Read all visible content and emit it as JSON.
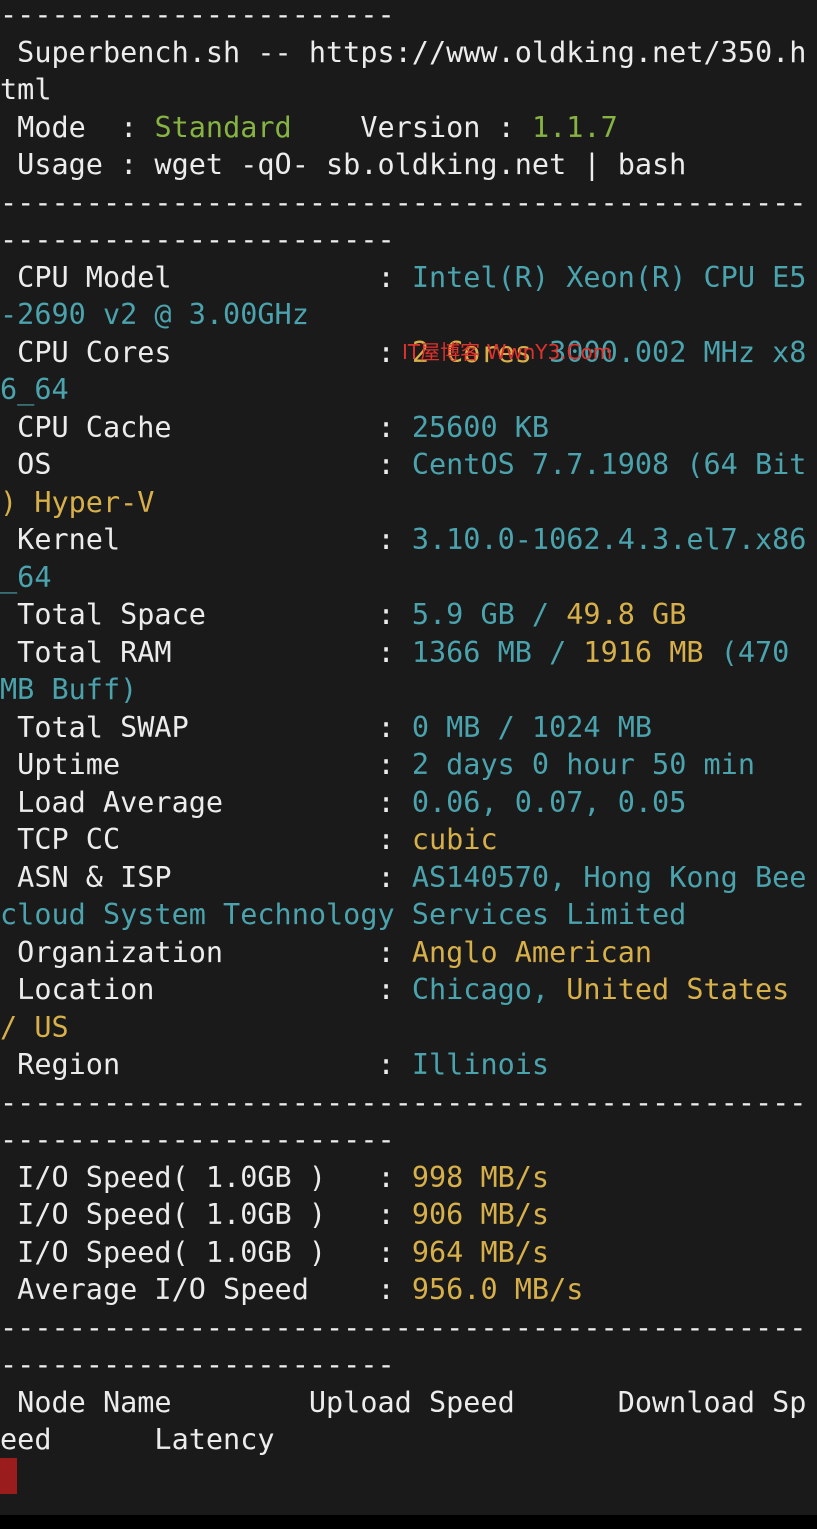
{
  "terminal": {
    "lines": [
      [
        {
          "t": "-----------------------",
          "c": "w"
        }
      ],
      [
        {
          "t": " Superbench.sh -- https://www.oldking.net/350.h",
          "c": "w"
        }
      ],
      [
        {
          "t": "tml",
          "c": "w"
        }
      ],
      [
        {
          "t": " Mode  : ",
          "c": "w"
        },
        {
          "t": "Standard",
          "c": "g"
        },
        {
          "t": "    Version : ",
          "c": "w"
        },
        {
          "t": "1.1.7",
          "c": "g"
        }
      ],
      [
        {
          "t": " Usage : wget -qO- sb.oldking.net | bash",
          "c": "w"
        }
      ],
      [
        {
          "t": "-----------------------------------------------",
          "c": "w"
        }
      ],
      [
        {
          "t": "-----------------------",
          "c": "w"
        }
      ],
      [
        {
          "t": " CPU Model            : ",
          "c": "w"
        },
        {
          "t": "Intel(R) Xeon(R) CPU E5",
          "c": "c"
        }
      ],
      [
        {
          "t": "-2690 v2 @ 3.00GHz",
          "c": "c"
        }
      ],
      [
        {
          "t": " CPU Cores            : ",
          "c": "w"
        },
        {
          "t": "2 Cores ",
          "c": "y"
        },
        {
          "t": "3000.002 MHz x8",
          "c": "c"
        }
      ],
      [
        {
          "t": "6_64",
          "c": "c"
        }
      ],
      [
        {
          "t": " CPU Cache            : ",
          "c": "w"
        },
        {
          "t": "25600 KB",
          "c": "c"
        }
      ],
      [
        {
          "t": " OS                   : ",
          "c": "w"
        },
        {
          "t": "CentOS 7.7.1908 (64 Bit",
          "c": "c"
        }
      ],
      [
        {
          "t": ") Hyper-V",
          "c": "y"
        }
      ],
      [
        {
          "t": " Kernel               : ",
          "c": "w"
        },
        {
          "t": "3.10.0-1062.4.3.el7.x86",
          "c": "c"
        }
      ],
      [
        {
          "t": "_64",
          "c": "c"
        }
      ],
      [
        {
          "t": " Total Space          : ",
          "c": "w"
        },
        {
          "t": "5.9 GB / ",
          "c": "c"
        },
        {
          "t": "49.8 GB",
          "c": "y"
        }
      ],
      [
        {
          "t": " Total RAM            : ",
          "c": "w"
        },
        {
          "t": "1366 MB / ",
          "c": "c"
        },
        {
          "t": "1916 MB",
          "c": "y"
        },
        {
          "t": " (470",
          "c": "c"
        }
      ],
      [
        {
          "t": "MB Buff)",
          "c": "c"
        }
      ],
      [
        {
          "t": " Total SWAP           : ",
          "c": "w"
        },
        {
          "t": "0 MB / 1024 MB",
          "c": "c"
        }
      ],
      [
        {
          "t": " Uptime               : ",
          "c": "w"
        },
        {
          "t": "2 days 0 hour 50 min",
          "c": "c"
        }
      ],
      [
        {
          "t": " Load Average         : ",
          "c": "w"
        },
        {
          "t": "0.06, 0.07, 0.05",
          "c": "c"
        }
      ],
      [
        {
          "t": " TCP CC               : ",
          "c": "w"
        },
        {
          "t": "cubic",
          "c": "y"
        }
      ],
      [
        {
          "t": " ASN & ISP            : ",
          "c": "w"
        },
        {
          "t": "AS140570, Hong Kong Bee",
          "c": "c"
        }
      ],
      [
        {
          "t": "cloud System Technology Services Limited",
          "c": "c"
        }
      ],
      [
        {
          "t": " Organization         : ",
          "c": "w"
        },
        {
          "t": "Anglo American",
          "c": "y"
        }
      ],
      [
        {
          "t": " Location             : ",
          "c": "w"
        },
        {
          "t": "Chicago, ",
          "c": "c"
        },
        {
          "t": "United States",
          "c": "y"
        }
      ],
      [
        {
          "t": "/ US",
          "c": "y"
        }
      ],
      [
        {
          "t": " Region               : ",
          "c": "w"
        },
        {
          "t": "Illinois",
          "c": "c"
        }
      ],
      [
        {
          "t": "-----------------------------------------------",
          "c": "w"
        }
      ],
      [
        {
          "t": "-----------------------",
          "c": "w"
        }
      ],
      [
        {
          "t": " I/O Speed( 1.0GB )   : ",
          "c": "w"
        },
        {
          "t": "998 MB/s",
          "c": "y"
        }
      ],
      [
        {
          "t": " I/O Speed( 1.0GB )   : ",
          "c": "w"
        },
        {
          "t": "906 MB/s",
          "c": "y"
        }
      ],
      [
        {
          "t": " I/O Speed( 1.0GB )   : ",
          "c": "w"
        },
        {
          "t": "964 MB/s",
          "c": "y"
        }
      ],
      [
        {
          "t": " Average I/O Speed    : ",
          "c": "w"
        },
        {
          "t": "956.0 MB/s",
          "c": "y"
        }
      ],
      [
        {
          "t": "-----------------------------------------------",
          "c": "w"
        }
      ],
      [
        {
          "t": "-----------------------",
          "c": "w"
        }
      ],
      [
        {
          "t": " Node Name        Upload Speed      Download Sp",
          "c": "w"
        }
      ],
      [
        {
          "t": "eed      Latency",
          "c": "w"
        }
      ]
    ],
    "watermark": "IT屋博客 WwnY3.Com"
  },
  "colors": {
    "background": "#1a1a1a",
    "text": "#ececec",
    "green": "#86b342",
    "cyan": "#4aa3ad",
    "yellow": "#d8b04a",
    "cursor": "#9b1c1c",
    "watermark": "#e0322d"
  }
}
